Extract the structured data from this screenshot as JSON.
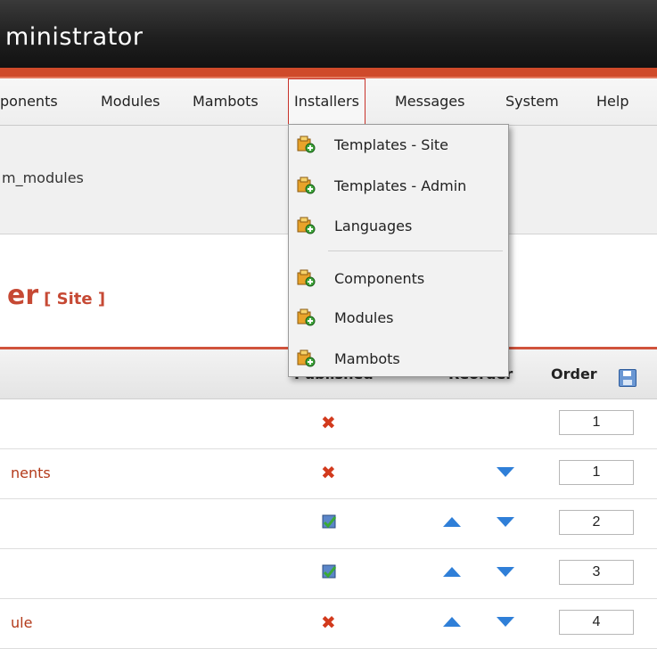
{
  "header": {
    "title": "ministrator"
  },
  "menubar": {
    "items": [
      "ponents",
      "Modules",
      "Mambots",
      "Installers",
      "Messages",
      "System",
      "Help"
    ]
  },
  "pathway": {
    "text": "m_modules"
  },
  "section": {
    "title": "er",
    "subtitle": "[ Site ]"
  },
  "table": {
    "headers": {
      "published": "Published",
      "reorder": "Reorder",
      "order": "Order"
    },
    "rows": [
      {
        "name": "",
        "published": "no",
        "up": false,
        "down": false,
        "order": "1"
      },
      {
        "name": "nents",
        "published": "no",
        "up": false,
        "down": true,
        "order": "1"
      },
      {
        "name": "",
        "published": "yes",
        "up": true,
        "down": true,
        "order": "2"
      },
      {
        "name": "",
        "published": "yes",
        "up": true,
        "down": true,
        "order": "3"
      },
      {
        "name": "ule",
        "published": "no",
        "up": true,
        "down": true,
        "order": "4"
      }
    ]
  },
  "dropdown": {
    "items": [
      {
        "label": "Templates - Site",
        "icon": "installer-icon"
      },
      {
        "label": "Templates - Admin",
        "icon": "installer-icon"
      },
      {
        "label": "Languages",
        "icon": "installer-icon"
      },
      {
        "label": "Components",
        "icon": "installer-icon"
      },
      {
        "label": "Modules",
        "icon": "installer-icon"
      },
      {
        "label": "Mambots",
        "icon": "installer-icon"
      }
    ]
  },
  "colors": {
    "accent": "#cf4a2a",
    "link": "#b33a1a",
    "arrow": "#2f7fd8"
  }
}
